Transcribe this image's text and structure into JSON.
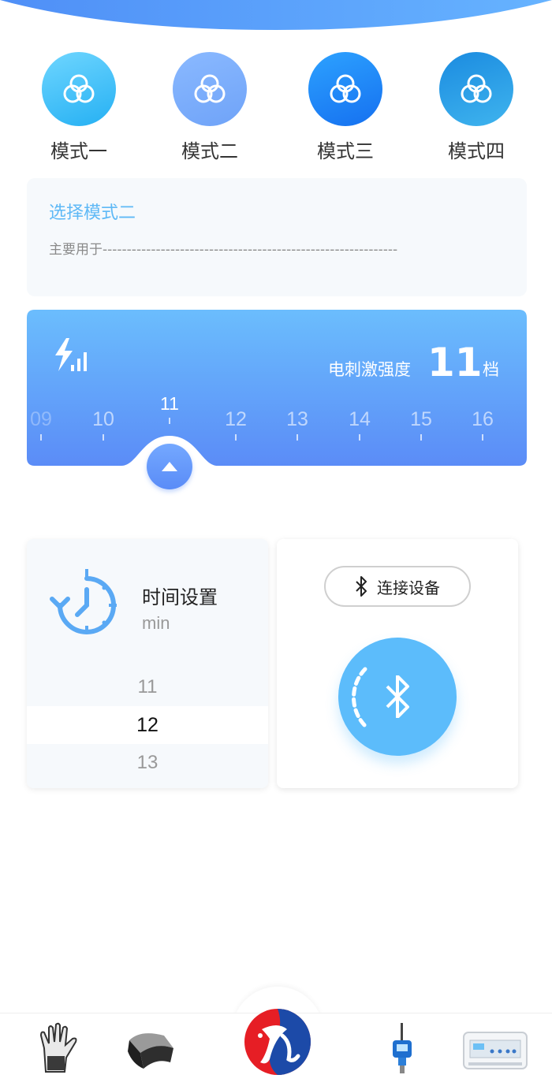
{
  "header": {
    "wave_color_start": "#4f8ff7",
    "wave_color_end": "#66b3ff"
  },
  "modes": [
    {
      "label": "模式一",
      "icon": "three-circles-icon"
    },
    {
      "label": "模式二",
      "icon": "three-circles-icon"
    },
    {
      "label": "模式三",
      "icon": "three-circles-icon"
    },
    {
      "label": "模式四",
      "icon": "three-circles-icon"
    }
  ],
  "description": {
    "title": "选择模式二",
    "body": "主要用于-------------------------------------------------------------"
  },
  "intensity": {
    "label": "电刺激强度",
    "value": "11",
    "unit": "档",
    "ruler": [
      "09",
      "10",
      "11",
      "12",
      "13",
      "14",
      "15",
      "16"
    ],
    "current": "11",
    "colors": {
      "top": "#6bbdfd",
      "bottom": "#5b8cf7"
    }
  },
  "time": {
    "title": "时间设置",
    "unit": "min",
    "options": [
      "11",
      "12",
      "13"
    ],
    "selected": "12"
  },
  "bluetooth": {
    "connect_label": "连接设备",
    "accent": "#5cbcfb"
  },
  "bottom_nav": [
    {
      "name": "glove",
      "icon": "glove-icon"
    },
    {
      "name": "wrap",
      "icon": "wrap-band-icon"
    },
    {
      "name": "logo",
      "icon": "brand-logo-icon"
    },
    {
      "name": "sensor",
      "icon": "sensor-probe-icon"
    },
    {
      "name": "device",
      "icon": "stimulator-device-icon"
    }
  ]
}
